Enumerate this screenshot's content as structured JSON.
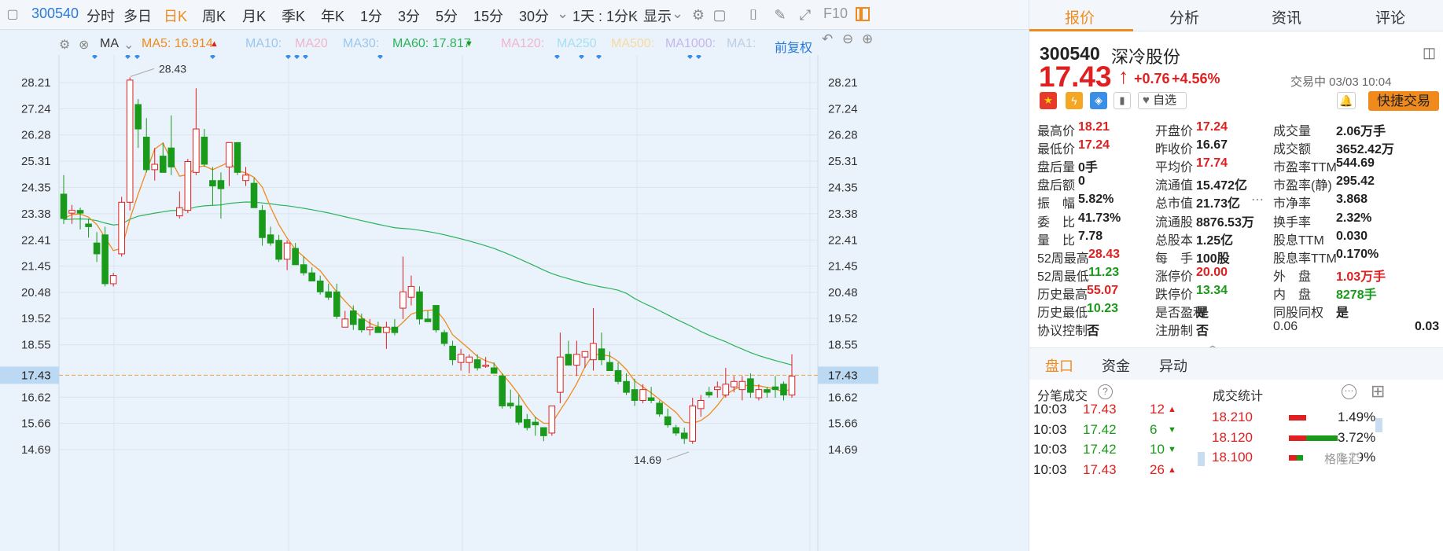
{
  "toolbar": {
    "code": "300540",
    "tabs": [
      "分时",
      "多日",
      "日K",
      "周K",
      "月K",
      "季K",
      "年K",
      "1分",
      "3分",
      "5分",
      "15分",
      "30分"
    ],
    "active": "日K",
    "combo": "1天 : 1分K",
    "display": "显示",
    "f10": "F10"
  },
  "ma_bar": {
    "ma": "MA",
    "ma5": "MA5: 16.914",
    "ma10": "MA10:",
    "ma20": "MA20",
    "ma30": "MA30:",
    "ma60": "MA60: 17.817",
    "ma120": "MA120:",
    "ma250": "MA250",
    "ma500": "MA500:",
    "ma1000": "MA1000:",
    "ma1": "MA1:",
    "fuquan": "前复权"
  },
  "colors": {
    "up": "#e02020",
    "down": "#1a9a1a",
    "ma5": "#f08a1c",
    "ma60": "#2bb35a",
    "accent": "#f08a1c"
  },
  "chart_data": {
    "type": "candlestick",
    "y_ticks": [
      "28.21",
      "27.24",
      "26.28",
      "25.31",
      "24.35",
      "23.38",
      "22.41",
      "21.45",
      "20.48",
      "19.52",
      "18.55",
      "17.43",
      "16.62",
      "15.66",
      "14.69"
    ],
    "ylim": [
      14.2,
      29.0
    ],
    "current_price": "17.43",
    "annotations": {
      "high": "28.43",
      "low": "14.69"
    },
    "candles": [
      [
        24.1,
        24.8,
        23.0,
        23.2
      ],
      [
        23.4,
        23.7,
        23.0,
        23.5
      ],
      [
        23.5,
        23.6,
        22.8,
        23.4
      ],
      [
        23.0,
        23.2,
        22.5,
        22.9
      ],
      [
        22.3,
        22.7,
        21.6,
        21.9
      ],
      [
        22.6,
        22.9,
        20.7,
        20.8
      ],
      [
        20.8,
        21.2,
        20.7,
        21.1
      ],
      [
        21.9,
        24.0,
        21.8,
        23.8
      ],
      [
        23.8,
        28.4,
        23.5,
        28.3
      ],
      [
        27.4,
        27.6,
        25.8,
        26.5
      ],
      [
        26.2,
        26.9,
        24.9,
        25.0
      ],
      [
        25.0,
        25.8,
        24.6,
        25.2
      ],
      [
        25.5,
        26.0,
        24.9,
        24.9
      ],
      [
        25.8,
        27.0,
        24.8,
        25.1
      ],
      [
        23.3,
        24.2,
        23.2,
        23.6
      ],
      [
        23.5,
        25.4,
        23.4,
        25.3
      ],
      [
        24.9,
        28.0,
        24.8,
        26.5
      ],
      [
        26.2,
        26.5,
        25.1,
        25.2
      ],
      [
        24.6,
        25.1,
        23.7,
        24.4
      ],
      [
        24.6,
        24.9,
        23.2,
        24.3
      ],
      [
        25.1,
        26.0,
        24.4,
        26.0
      ],
      [
        26.0,
        26.0,
        24.8,
        24.9
      ],
      [
        24.6,
        25.1,
        24.4,
        24.8
      ],
      [
        24.5,
        24.7,
        23.7,
        23.6
      ],
      [
        23.5,
        23.7,
        22.2,
        22.5
      ],
      [
        22.6,
        22.9,
        22.2,
        22.3
      ],
      [
        22.4,
        22.6,
        21.6,
        21.7
      ],
      [
        21.7,
        22.4,
        21.3,
        22.3
      ],
      [
        22.1,
        22.3,
        21.6,
        21.5
      ],
      [
        21.5,
        21.8,
        21.1,
        21.2
      ],
      [
        21.2,
        21.4,
        20.9,
        20.9
      ],
      [
        20.9,
        21.1,
        20.4,
        20.5
      ],
      [
        20.5,
        20.8,
        20.2,
        20.3
      ],
      [
        20.5,
        20.8,
        19.5,
        19.6
      ],
      [
        19.2,
        19.8,
        19.2,
        19.5
      ],
      [
        19.8,
        20.0,
        19.1,
        19.3
      ],
      [
        19.5,
        19.7,
        19.0,
        19.1
      ],
      [
        19.1,
        19.5,
        18.9,
        19.2
      ],
      [
        19.2,
        19.4,
        19.0,
        19.0
      ],
      [
        19.0,
        19.4,
        18.4,
        19.2
      ],
      [
        19.2,
        19.5,
        18.9,
        19.0
      ],
      [
        19.9,
        21.8,
        19.5,
        20.5
      ],
      [
        20.3,
        21.1,
        20.0,
        20.7
      ],
      [
        20.5,
        20.7,
        19.3,
        19.5
      ],
      [
        19.5,
        19.8,
        19.4,
        19.4
      ],
      [
        20.0,
        20.0,
        19.0,
        19.1
      ],
      [
        19.0,
        19.1,
        18.5,
        18.6
      ],
      [
        18.5,
        18.7,
        17.8,
        18.0
      ],
      [
        17.9,
        18.4,
        17.6,
        18.2
      ],
      [
        17.9,
        18.2,
        17.5,
        18.1
      ],
      [
        18.0,
        18.2,
        17.6,
        17.7
      ],
      [
        17.8,
        18.1,
        17.7,
        17.8
      ],
      [
        17.7,
        17.9,
        17.5,
        17.5
      ],
      [
        17.4,
        17.5,
        16.2,
        16.3
      ],
      [
        16.4,
        16.9,
        16.2,
        16.3
      ],
      [
        16.3,
        16.7,
        15.6,
        15.7
      ],
      [
        15.8,
        16.0,
        15.4,
        15.5
      ],
      [
        15.7,
        15.9,
        15.2,
        15.6
      ],
      [
        15.5,
        15.5,
        15.0,
        15.2
      ],
      [
        15.3,
        16.3,
        15.2,
        16.3
      ],
      [
        16.8,
        19.0,
        16.4,
        18.1
      ],
      [
        18.2,
        18.7,
        17.8,
        17.8
      ],
      [
        17.8,
        18.7,
        17.4,
        18.2
      ],
      [
        18.1,
        18.3,
        17.7,
        18.3
      ],
      [
        18.0,
        19.9,
        17.6,
        18.6
      ],
      [
        18.4,
        19.0,
        17.8,
        18.0
      ],
      [
        17.9,
        18.3,
        17.6,
        17.6
      ],
      [
        17.6,
        17.9,
        17.1,
        17.2
      ],
      [
        17.2,
        17.5,
        16.7,
        16.8
      ],
      [
        16.9,
        17.3,
        16.3,
        16.5
      ],
      [
        16.5,
        17.1,
        16.4,
        16.9
      ],
      [
        16.6,
        17.0,
        16.4,
        16.5
      ],
      [
        16.4,
        16.5,
        15.9,
        16.0
      ],
      [
        15.9,
        16.2,
        15.5,
        15.6
      ],
      [
        15.5,
        15.6,
        15.2,
        15.3
      ],
      [
        15.3,
        15.5,
        14.9,
        15.1
      ],
      [
        15.0,
        16.6,
        14.9,
        16.3
      ],
      [
        16.2,
        16.7,
        15.9,
        16.5
      ],
      [
        16.8,
        17.0,
        16.6,
        16.7
      ],
      [
        16.9,
        17.2,
        16.6,
        17.0
      ],
      [
        16.7,
        17.7,
        16.6,
        17.1
      ],
      [
        17.0,
        17.4,
        16.8,
        17.2
      ],
      [
        16.9,
        17.4,
        16.5,
        17.2
      ],
      [
        17.3,
        17.5,
        16.6,
        16.8
      ],
      [
        16.6,
        17.1,
        16.5,
        16.9
      ],
      [
        16.9,
        17.0,
        16.6,
        16.8
      ],
      [
        17.0,
        17.4,
        16.6,
        16.9
      ],
      [
        17.1,
        17.2,
        16.5,
        16.7
      ],
      [
        16.7,
        18.2,
        16.6,
        17.4
      ]
    ]
  },
  "quote": {
    "code": "300540",
    "name": "深冷股份",
    "price": "17.43",
    "arrow": "↑",
    "change": "+0.76",
    "pct": "+4.56%",
    "status": "交易中 03/03 10:04",
    "fav": "自选",
    "trade": "快捷交易",
    "collapse": "︿",
    "col1": [
      [
        "最高价",
        "18.21",
        "red"
      ],
      [
        "最低价",
        "17.24",
        "red"
      ],
      [
        "盘后量",
        "0手",
        "dark"
      ],
      [
        "盘后额",
        "0",
        "dark"
      ],
      [
        "振　幅",
        "5.82%",
        "dark"
      ],
      [
        "委　比",
        "41.73%",
        "dark"
      ],
      [
        "量　比",
        "7.78",
        "dark"
      ],
      [
        "52周最高",
        "28.43",
        "red"
      ],
      [
        "52周最低",
        "11.23",
        "green"
      ],
      [
        "历史最高",
        "55.07",
        "red"
      ],
      [
        "历史最低",
        "10.23",
        "green"
      ],
      [
        "协议控制",
        "否",
        "dark"
      ]
    ],
    "col2": [
      [
        "开盘价",
        "17.24",
        "red"
      ],
      [
        "昨收价",
        "16.67",
        "dark"
      ],
      [
        "平均价",
        "17.74",
        "red"
      ],
      [
        "流通值",
        "15.472亿",
        "dark"
      ],
      [
        "总市值",
        "21.73亿",
        "dark"
      ],
      [
        "流通股",
        "8876.53万",
        "dark"
      ],
      [
        "总股本",
        "1.25亿",
        "dark"
      ],
      [
        "每　手",
        "100股",
        "dark"
      ],
      [
        "涨停价",
        "20.00",
        "red"
      ],
      [
        "跌停价",
        "13.34",
        "green"
      ],
      [
        "是否盈利",
        "是",
        "dark"
      ],
      [
        "注册制",
        "否",
        "dark"
      ]
    ],
    "col3": [
      [
        "成交量",
        "2.06万手",
        "dark"
      ],
      [
        "成交额",
        "3652.42万",
        "dark"
      ],
      [
        "市盈率TTM",
        "544.69",
        "dark"
      ],
      [
        "市盈率(静)",
        "295.42",
        "dark"
      ],
      [
        "市净率",
        "3.868",
        "dark"
      ],
      [
        "换手率",
        "2.32%",
        "dark"
      ],
      [
        "股息TTM",
        "0.030",
        "dark"
      ],
      [
        "股息率TTM",
        "0.170%",
        "dark"
      ],
      [
        "外　盘",
        "1.03万手",
        "red"
      ],
      [
        "内　盘",
        "8278手",
        "green"
      ],
      [
        "同股同权",
        "是",
        "dark"
      ],
      [
        "0.06",
        "0.03",
        "dark"
      ]
    ]
  },
  "right_tabs": [
    "报价",
    "分析",
    "资讯",
    "评论"
  ],
  "sub_tabs": [
    "盘口",
    "资金",
    "异动"
  ],
  "trades": {
    "title": "分笔成交",
    "rows": [
      [
        "10:03",
        "17.43",
        "12",
        "▲",
        "red"
      ],
      [
        "10:03",
        "17.42",
        "6",
        "▼",
        "green"
      ],
      [
        "10:03",
        "17.42",
        "10",
        "▼",
        "green"
      ],
      [
        "10:03",
        "17.43",
        "26",
        "▲",
        "red"
      ]
    ]
  },
  "stats": {
    "title": "成交统计",
    "rows": [
      [
        "18.210",
        "1.49%"
      ],
      [
        "18.120",
        "3.72%"
      ],
      [
        "18.100",
        "1.29%"
      ]
    ]
  },
  "watermark": "格隆汇"
}
